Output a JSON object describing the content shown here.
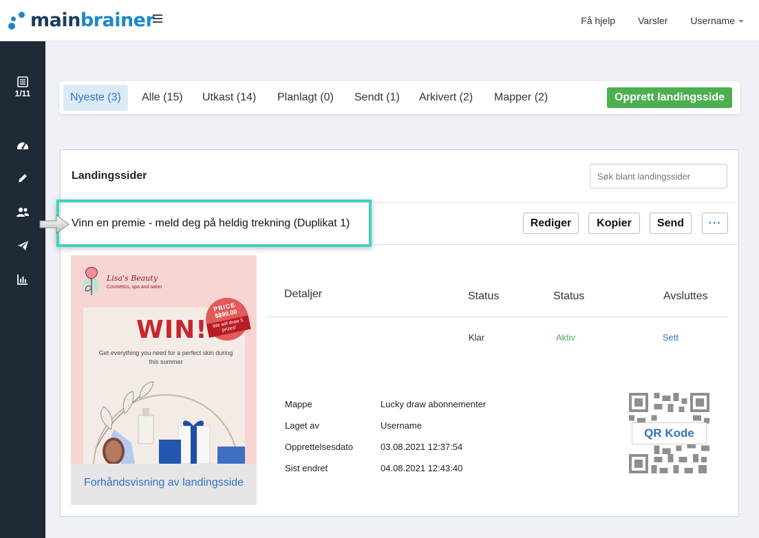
{
  "header": {
    "logo_part1": "main",
    "logo_part2": "brainer",
    "nav": {
      "help": "Få hjelp",
      "alerts": "Varsler",
      "user": "Username"
    }
  },
  "sidebar": {
    "counter": "1/11",
    "icons": [
      "list-icon",
      "dashboard-icon",
      "pencil-icon",
      "users-icon",
      "send-icon",
      "chart-icon"
    ]
  },
  "tabs": [
    {
      "label": "Nyeste (3)"
    },
    {
      "label": "Alle (15)"
    },
    {
      "label": "Utkast (14)"
    },
    {
      "label": "Planlagt (0)"
    },
    {
      "label": "Sendt (1)"
    },
    {
      "label": "Arkivert (2)"
    },
    {
      "label": "Mapper (2)"
    }
  ],
  "create_button": "Opprett landingsside",
  "panel": {
    "title": "Landingssider",
    "search_placeholder": "Søk blant landingssider"
  },
  "landing_page": {
    "name": "Vinn en premie - meld deg på heldig trekning (Duplikat 1)",
    "actions": {
      "edit": "Rediger",
      "copy": "Kopier",
      "send": "Send",
      "more": "···"
    },
    "preview": {
      "brand": "Lisa's Beauty",
      "brand_sub": "Cosmetics, spa and salon",
      "headline": "WIN!",
      "subtext": "Get everything you need for a perfect skin during this summer",
      "badge_price_label": "PRICE",
      "badge_price": "$890.00",
      "badge_note": "We will draw 5 prizes!",
      "link": "Forhåndsvisning av landingsside"
    },
    "table": {
      "headers": {
        "details": "Detaljer",
        "status1": "Status",
        "status2": "Status",
        "ends": "Avsluttes"
      },
      "values": {
        "status1": "Klar",
        "status2": "Aktiv",
        "ends": "Sett"
      },
      "colors": {
        "status2": "#4caf50",
        "ends": "#2f72c4"
      }
    },
    "meta": [
      {
        "label": "Mappe",
        "value": "Lucky draw abonnementer"
      },
      {
        "label": "Laget av",
        "value": "Username"
      },
      {
        "label": "Opprettelsesdato",
        "value": "03.08.2021 12:37:54"
      },
      {
        "label": "Sist endret",
        "value": "04.08.2021 12:43:40"
      }
    ],
    "qr_label": "QR Kode"
  },
  "colors": {
    "accent": "#2f72c4",
    "brand_blue": "#1e88c8",
    "create_green": "#4caf50",
    "highlight": "#3fd1c2",
    "sidebar_bg": "#1f2a37"
  }
}
